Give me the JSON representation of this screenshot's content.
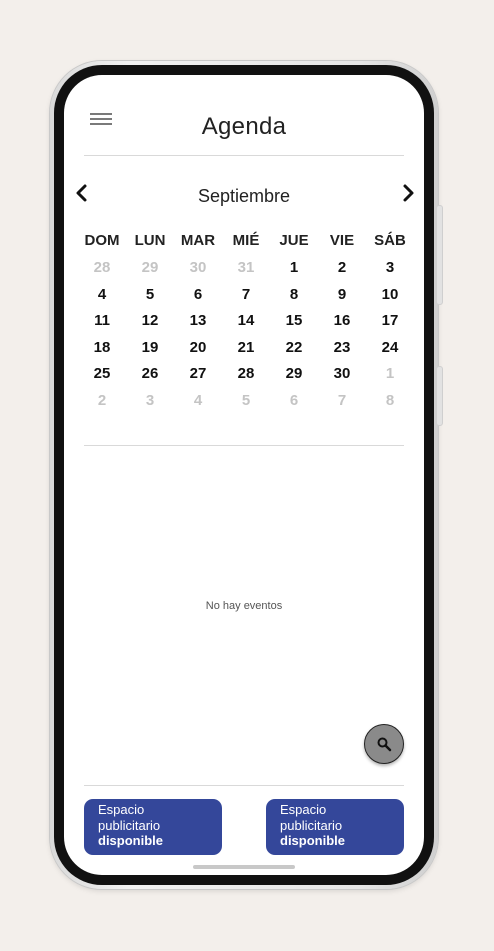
{
  "header": {
    "title": "Agenda"
  },
  "calendar": {
    "month": "Septiembre",
    "weekdays": [
      "DOM",
      "LUN",
      "MAR",
      "MIÉ",
      "JUE",
      "VIE",
      "SÁB"
    ],
    "weeks": [
      [
        {
          "d": "28",
          "m": true
        },
        {
          "d": "29",
          "m": true
        },
        {
          "d": "30",
          "m": true
        },
        {
          "d": "31",
          "m": true
        },
        {
          "d": "1",
          "m": false
        },
        {
          "d": "2",
          "m": false
        },
        {
          "d": "3",
          "m": false
        }
      ],
      [
        {
          "d": "4",
          "m": false
        },
        {
          "d": "5",
          "m": false
        },
        {
          "d": "6",
          "m": false
        },
        {
          "d": "7",
          "m": false
        },
        {
          "d": "8",
          "m": false
        },
        {
          "d": "9",
          "m": false
        },
        {
          "d": "10",
          "m": false
        }
      ],
      [
        {
          "d": "11",
          "m": false
        },
        {
          "d": "12",
          "m": false
        },
        {
          "d": "13",
          "m": false
        },
        {
          "d": "14",
          "m": false
        },
        {
          "d": "15",
          "m": false
        },
        {
          "d": "16",
          "m": false
        },
        {
          "d": "17",
          "m": false
        }
      ],
      [
        {
          "d": "18",
          "m": false
        },
        {
          "d": "19",
          "m": false
        },
        {
          "d": "20",
          "m": false
        },
        {
          "d": "21",
          "m": false
        },
        {
          "d": "22",
          "m": false
        },
        {
          "d": "23",
          "m": false
        },
        {
          "d": "24",
          "m": false
        }
      ],
      [
        {
          "d": "25",
          "m": false
        },
        {
          "d": "26",
          "m": false
        },
        {
          "d": "27",
          "m": false
        },
        {
          "d": "28",
          "m": false
        },
        {
          "d": "29",
          "m": false
        },
        {
          "d": "30",
          "m": false
        },
        {
          "d": "1",
          "m": true
        }
      ],
      [
        {
          "d": "2",
          "m": true
        },
        {
          "d": "3",
          "m": true
        },
        {
          "d": "4",
          "m": true
        },
        {
          "d": "5",
          "m": true
        },
        {
          "d": "6",
          "m": true
        },
        {
          "d": "7",
          "m": true
        },
        {
          "d": "8",
          "m": true
        }
      ]
    ]
  },
  "events": {
    "empty_text": "No hay eventos"
  },
  "ads": [
    {
      "line1": "Espacio",
      "line2": "publicitario",
      "line3": "disponible"
    },
    {
      "line1": "Espacio",
      "line2": "publicitario",
      "line3": "disponible"
    }
  ],
  "colors": {
    "ad_background": "#34479a",
    "muted_day": "#c4c4c4",
    "fab": "#8a8a8a"
  },
  "icons": {
    "menu": "hamburger-menu-icon",
    "prev": "chevron-left-icon",
    "next": "chevron-right-icon",
    "search": "search-icon"
  }
}
